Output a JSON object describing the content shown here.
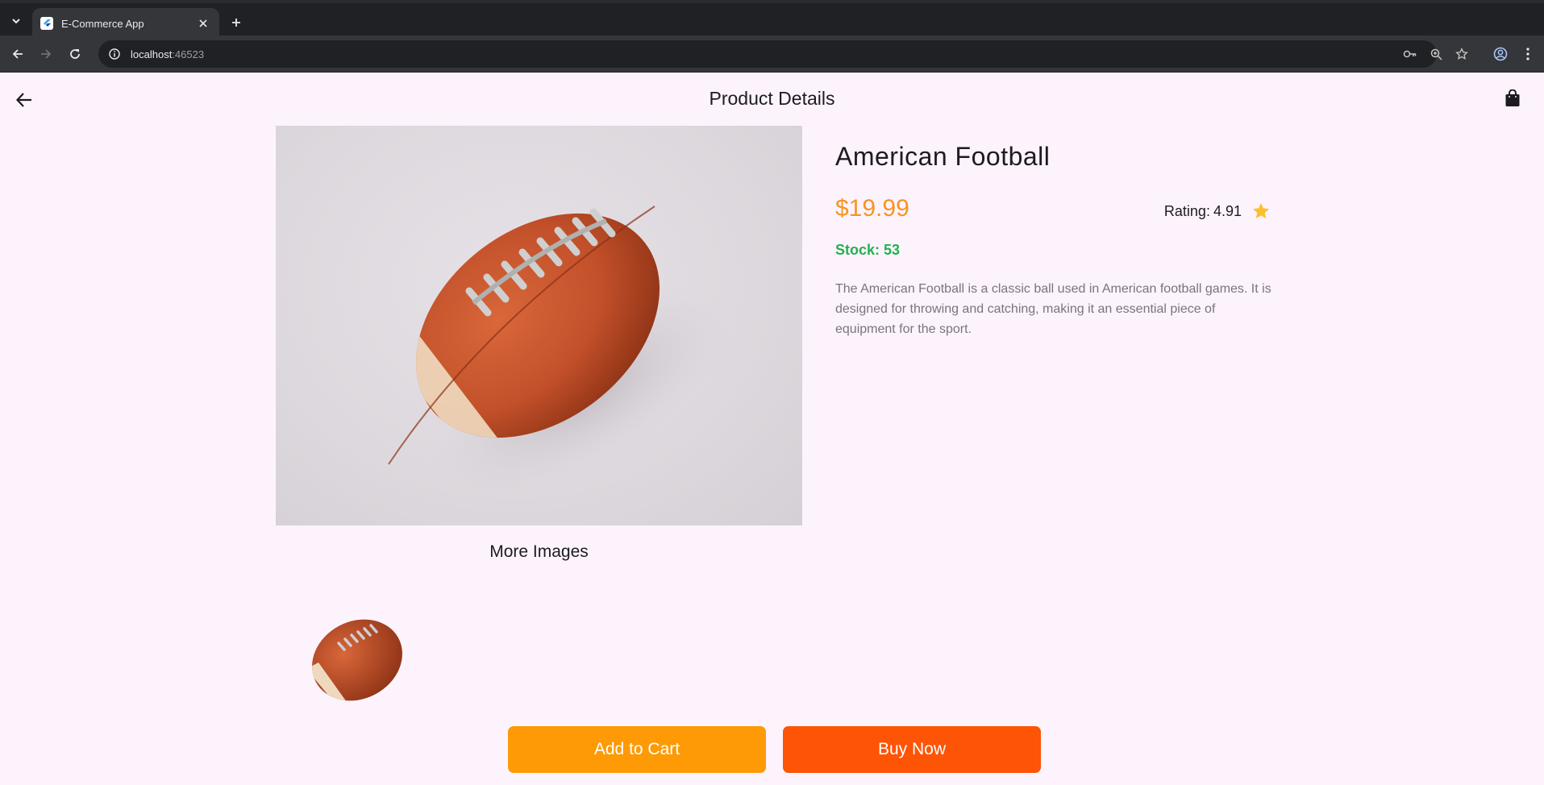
{
  "browser": {
    "tab_title": "E-Commerce App",
    "url_host": "localhost",
    "url_port": ":46523"
  },
  "app": {
    "title": "Product Details"
  },
  "product": {
    "name": "American Football",
    "price": "$19.99",
    "rating_label": "Rating:",
    "rating_value": "4.91",
    "stock_label": "Stock:",
    "stock_value": "53",
    "description": "The American Football is a classic ball used in American football games. It is designed for throwing and catching, making it an essential piece of equipment for the sport.",
    "more_images_label": "More Images"
  },
  "actions": {
    "add_to_cart": "Add to Cart",
    "buy_now": "Buy Now"
  },
  "colors": {
    "price": "#f79420",
    "stock": "#22b24c",
    "star": "#fbc02d",
    "add_to_cart_bg": "#fd9a06",
    "buy_now_bg": "#fd5406",
    "page_bg": "#fdf3fd"
  },
  "icons": [
    "tab-list-icon",
    "flutter-favicon",
    "close-icon",
    "plus-icon",
    "arrow-left-icon",
    "arrow-right-icon",
    "reload-icon",
    "info-icon",
    "key-icon",
    "zoom-icon",
    "star-outline-icon",
    "profile-icon",
    "more-vert-icon",
    "back-arrow-icon",
    "shopping-bag-icon",
    "star-icon"
  ]
}
